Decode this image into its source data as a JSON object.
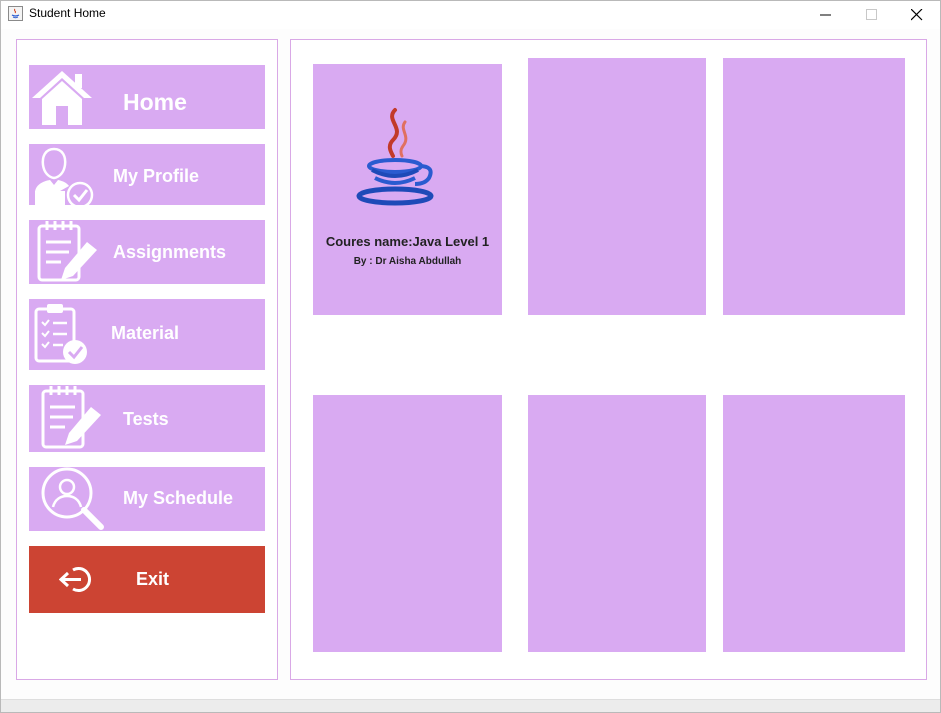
{
  "window": {
    "title": "Student Home",
    "icon": "java-icon"
  },
  "sidebar": {
    "items": [
      {
        "label": "Home",
        "icon": "house-icon"
      },
      {
        "label": "My Profile",
        "icon": "user-check-icon"
      },
      {
        "label": "Assignments",
        "icon": "notepad-pencil-icon"
      },
      {
        "label": "Material",
        "icon": "clipboard-check-icon"
      },
      {
        "label": "Tests",
        "icon": "notepad-pencil-icon"
      },
      {
        "label": "My Schedule",
        "icon": "user-search-icon"
      }
    ],
    "exit": {
      "label": "Exit",
      "icon": "exit-icon",
      "color": "#cc4433"
    }
  },
  "courses": [
    {
      "name": "Coures name:Java Level 1",
      "author": "By : Dr Aisha Abdullah",
      "icon": "java-logo"
    },
    {
      "name": "",
      "author": ""
    },
    {
      "name": "",
      "author": ""
    },
    {
      "name": "",
      "author": ""
    },
    {
      "name": "",
      "author": ""
    },
    {
      "name": "",
      "author": ""
    }
  ],
  "colors": {
    "accent": "#d9aaf2",
    "border": "#d9a8e6",
    "exit": "#cc4433"
  }
}
